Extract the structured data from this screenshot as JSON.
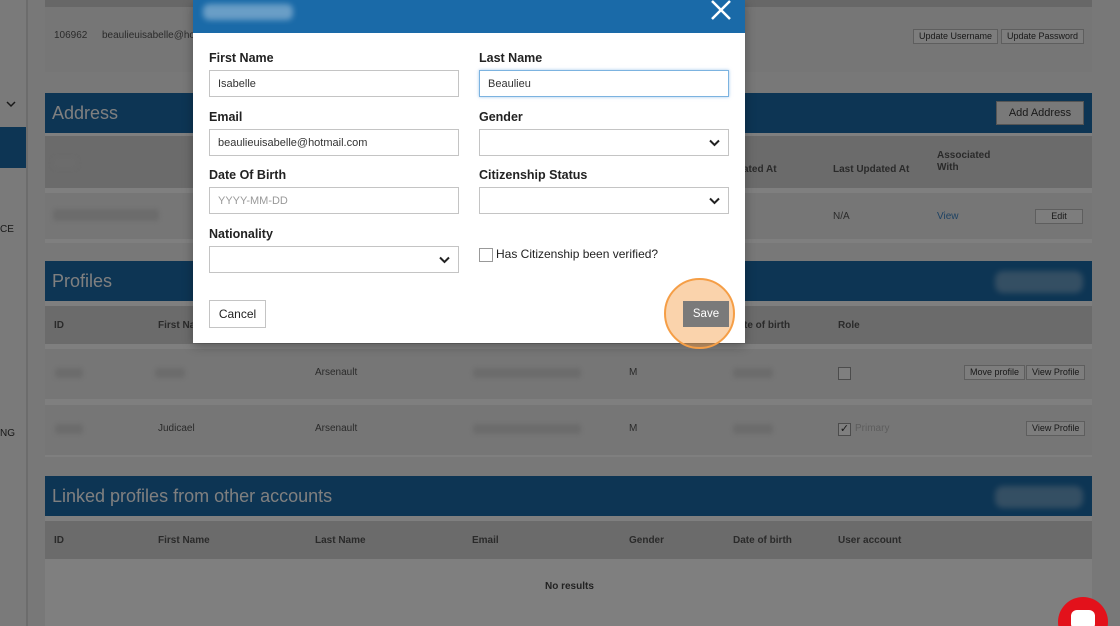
{
  "sidebar": {
    "text_ce": "CE",
    "text_ng": "NG"
  },
  "account": {
    "id": "106962",
    "email_prefix": "beaulieuisabelle@ho",
    "update_username": "Update Username",
    "update_password": "Update Password"
  },
  "address": {
    "title": "Address",
    "add_button": "Add Address",
    "columns": {
      "updated_at": "ated At",
      "last_updated_at": "Last Updated At",
      "associated_with": "Associated With"
    },
    "row": {
      "last_updated": "N/A",
      "view": "View",
      "edit": "Edit"
    }
  },
  "profiles": {
    "title": "Profiles",
    "columns": {
      "id": "ID",
      "first_name": "First Na",
      "dob": "te of birth",
      "role": "Role"
    },
    "rows": [
      {
        "first_name": "",
        "last_name": "Arsenault",
        "gender": "M",
        "role_checked": false,
        "role_label": "",
        "actions": [
          "Move profile",
          "View Profile"
        ]
      },
      {
        "first_name": "Judicael",
        "last_name": "Arsenault",
        "gender": "M",
        "role_checked": true,
        "role_label": "Primary",
        "actions": [
          "View Profile"
        ]
      }
    ]
  },
  "linked": {
    "title": "Linked profiles from other accounts",
    "columns": [
      "ID",
      "First Name",
      "Last Name",
      "Email",
      "Gender",
      "Date of birth",
      "User account"
    ],
    "empty": "No results"
  },
  "modal": {
    "first_name_label": "First Name",
    "first_name_value": "Isabelle",
    "last_name_label": "Last Name",
    "last_name_value": "Beaulieu",
    "email_label": "Email",
    "email_value": "beaulieuisabelle@hotmail.com",
    "gender_label": "Gender",
    "dob_label": "Date Of Birth",
    "dob_placeholder": "YYYY-MM-DD",
    "citizenship_label": "Citizenship Status",
    "nationality_label": "Nationality",
    "citizenship_verified_label": "Has Citizenship been verified?",
    "cancel_label": "Cancel",
    "save_label": "Save"
  },
  "colors": {
    "header_blue": "#1a6aa8",
    "highlight_orange": "#f59e46",
    "chat_red": "#e3111b"
  }
}
